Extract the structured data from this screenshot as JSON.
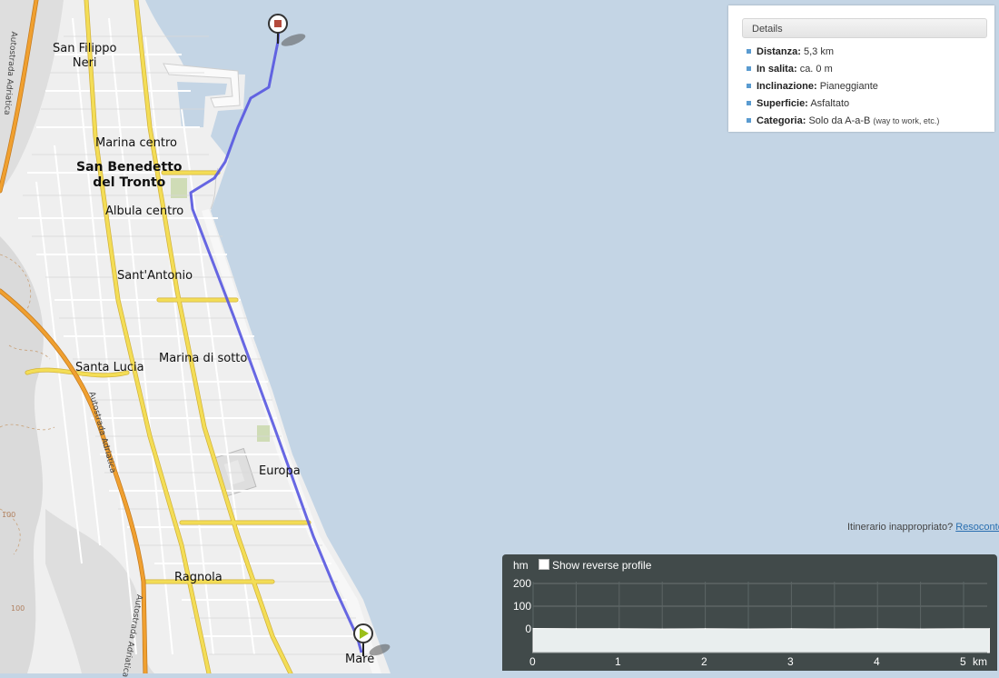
{
  "map": {
    "places": {
      "san_filippo_neri": "San Filippo\nNeri",
      "marina_centro": "Marina centro",
      "san_benedetto": "San Benedetto\ndel Tronto",
      "albula_centro": "Albula centro",
      "sant_antonio": "Sant'Antonio",
      "santa_lucia": "Santa Lucia",
      "marina_di_sotto": "Marina di sotto",
      "europa": "Europa",
      "ragnola": "Ragnola",
      "mare": "Mare"
    },
    "road_labels": {
      "autostrada_1": "Autostrada Adriatica",
      "autostrada_2": "Autostrada Adriatica",
      "autostrada_3": "Autostrada Adriatica"
    },
    "contour_labels": {
      "c1": "100",
      "c2": "100"
    },
    "colors": {
      "sea": "#c4d5e5",
      "land": "#efefef",
      "route": "#5656e0",
      "main_road": "#f3dd56",
      "highway": "#f0a030",
      "start_marker": "#9bbf1a",
      "end_marker": "#b44a3c"
    },
    "markers": {
      "start": "play-icon",
      "end": "stop-icon"
    }
  },
  "details": {
    "title": "Details",
    "items": [
      {
        "label": "Distanza:",
        "value": "5,3 km",
        "note": ""
      },
      {
        "label": "In salita:",
        "value": "ca. 0 m",
        "note": ""
      },
      {
        "label": "Inclinazione:",
        "value": "Pianeggiante",
        "note": ""
      },
      {
        "label": "Superficie:",
        "value": "Asfaltato",
        "note": ""
      },
      {
        "label": "Categoria:",
        "value": "Solo da A-a-B",
        "note": "(way to work, etc.)"
      }
    ]
  },
  "feedback": {
    "text": "Itinerario inappropriato?",
    "link": "Resoconto"
  },
  "profile": {
    "y_unit": "hm",
    "reverse_label": "Show reverse profile",
    "y_ticks": [
      "200",
      "100",
      "0"
    ],
    "x_ticks": [
      "0",
      "1",
      "2",
      "3",
      "4",
      "5"
    ],
    "x_unit": "km"
  },
  "chart_data": {
    "type": "area",
    "xlabel": "km",
    "ylabel": "hm",
    "xlim": [
      0,
      5.3
    ],
    "ylim": [
      0,
      250
    ],
    "x": [
      0,
      0.5,
      1,
      1.5,
      2,
      2.5,
      3,
      3.5,
      4,
      4.5,
      5,
      5.3
    ],
    "values": [
      2,
      1,
      1,
      0,
      1,
      0,
      1,
      0,
      1,
      0,
      1,
      1
    ],
    "grid": true
  }
}
